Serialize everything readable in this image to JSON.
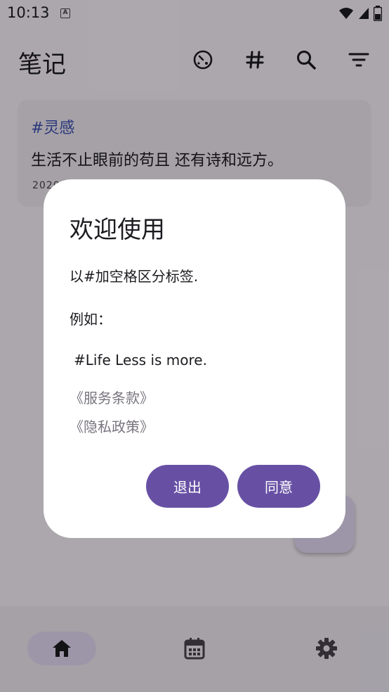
{
  "status": {
    "time": "10:13",
    "notification_icon": "A"
  },
  "header": {
    "title": "笔记",
    "icons": [
      "timer-icon",
      "hashtag-icon",
      "search-icon",
      "filter-icon"
    ]
  },
  "note": {
    "tag": "#灵感",
    "text": "生活不止眼前的苟且 还有诗和远方。",
    "date": "2020"
  },
  "dialog": {
    "title": "欢迎使用",
    "line1": "以#加空格区分标签.",
    "line2": "例如：",
    "line3": "#Life Less is more.",
    "link_terms": "《服务条款》",
    "link_privacy": "《隐私政策》",
    "exit_label": "退出",
    "agree_label": "同意"
  },
  "bottom_nav": {
    "items": [
      "home-icon",
      "calendar-icon",
      "settings-icon"
    ],
    "active": "home"
  },
  "colors": {
    "primary": "#6750a4",
    "tag": "#3f51b5",
    "link": "#79747e",
    "surface": "#f3edf7"
  }
}
